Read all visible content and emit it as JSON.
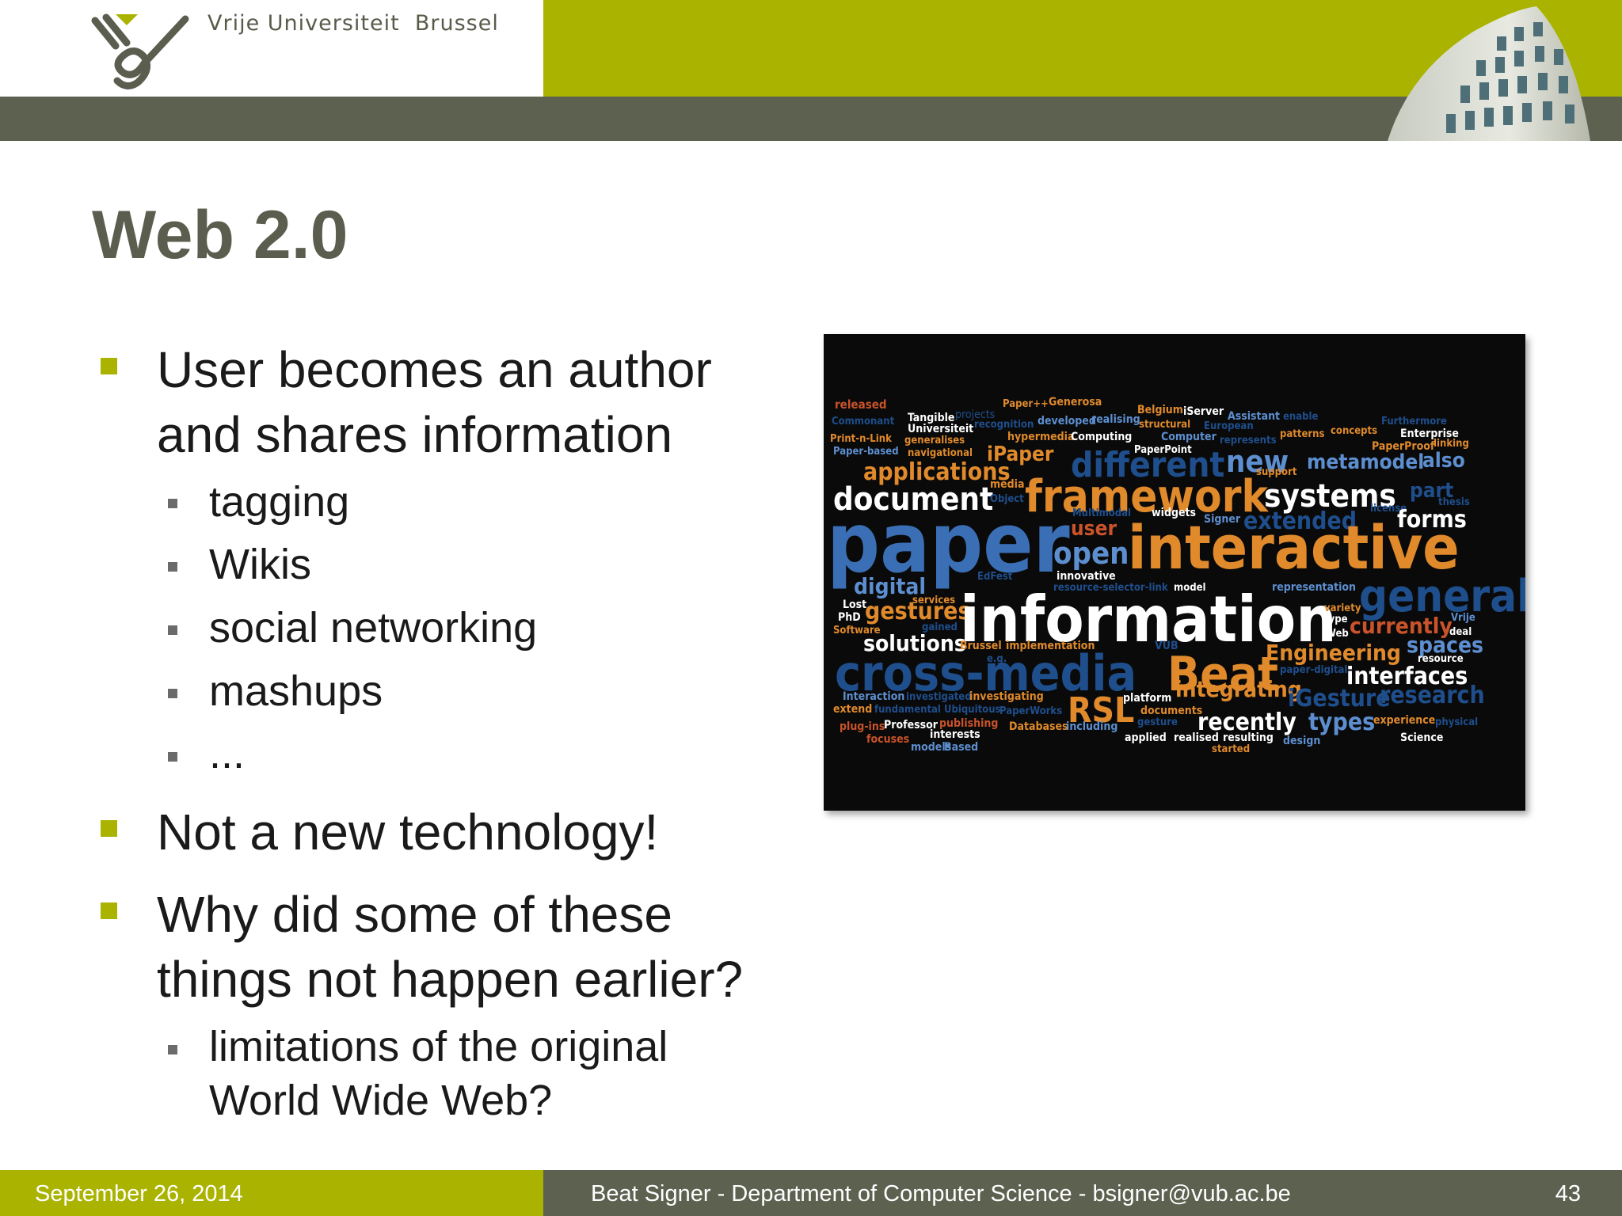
{
  "header": {
    "university": "Vrije Universiteit  Brussel"
  },
  "slide": {
    "title": "Web 2.0",
    "bullets": [
      {
        "lines": [
          "User becomes an author",
          "and shares information"
        ],
        "sub": [
          "tagging",
          "Wikis",
          "social networking",
          "mashups",
          "..."
        ]
      },
      {
        "lines": [
          "Not a new technology!"
        ],
        "sub": []
      },
      {
        "lines": [
          "Why did some of these",
          "things not happen earlier?"
        ],
        "sub": [
          [
            "limitations of the original",
            "World Wide Web?"
          ]
        ]
      }
    ]
  },
  "word_cloud": {
    "words": [
      "released",
      "Tangible",
      "projects",
      "Paper++",
      "Generosa",
      "Belgium",
      "iServer",
      "Assistant",
      "enable",
      "Furthermore",
      "Commonant",
      "Universiteit",
      "recognition",
      "developed",
      "realising",
      "structural",
      "European",
      "patterns",
      "concepts",
      "Enterprise",
      "Print-n-Link",
      "generalises",
      "hypermedia",
      "Computing",
      "Computer",
      "represents",
      "PaperProof",
      "linking",
      "Paper-based",
      "navigational",
      "iPaper",
      "PaperPoint",
      "different",
      "new",
      "metamodel",
      "also",
      "applications",
      "support",
      "media",
      "document",
      "framework",
      "systems",
      "part",
      "Object",
      "thesis",
      "Multimodal",
      "widgets",
      "license",
      "forms",
      "Signer",
      "extended",
      "paper",
      "user",
      "open",
      "interactive",
      "innovative",
      "digital",
      "EdFest",
      "resource-selector-link",
      "model",
      "representation",
      "general",
      "services",
      "Lost",
      "PhD",
      "gestures",
      "information",
      "variety",
      "type",
      "Vrije",
      "Software",
      "gained",
      "Web",
      "currently",
      "deal",
      "solutions",
      "Brussel",
      "implementation",
      "VUB",
      "Engineering",
      "spaces",
      "e.g.",
      "resource",
      "cross-media",
      "Beat",
      "paper-digital",
      "interfaces",
      "Interaction",
      "investigated",
      "investigating",
      "RSL",
      "platform",
      "integrating",
      "iGesture",
      "research",
      "extend",
      "fundamental",
      "Ubiquitous",
      "PaperWorks",
      "documents",
      "recently",
      "types",
      "experience",
      "physical",
      "plug-ins",
      "Professor",
      "publishing",
      "gesture",
      "Databases",
      "including",
      "applied",
      "realised",
      "resulting",
      "Science",
      "focuses",
      "interests",
      "design",
      "models",
      "Based",
      "started"
    ]
  },
  "footer": {
    "date": "September 26, 2014",
    "author": "Beat Signer - Department of Computer Science - bsigner@vub.ac.be",
    "page": "43"
  }
}
